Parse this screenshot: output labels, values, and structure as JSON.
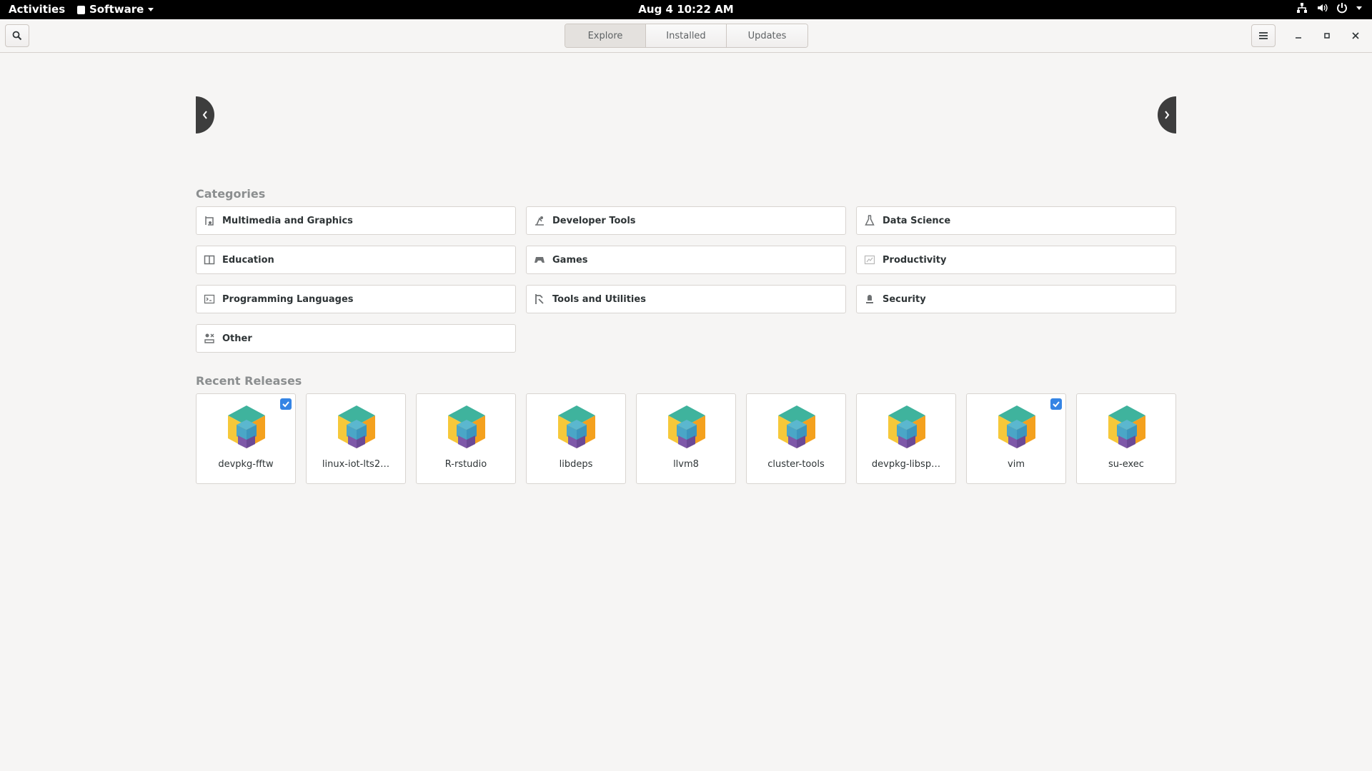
{
  "topbar": {
    "activities": "Activities",
    "app_menu": "Software",
    "clock": "Aug 4  10:22 AM"
  },
  "header": {
    "tabs": [
      {
        "label": "Explore",
        "active": true
      },
      {
        "label": "Installed",
        "active": false
      },
      {
        "label": "Updates",
        "active": false
      }
    ]
  },
  "categories": {
    "title": "Categories",
    "items": [
      {
        "label": "Multimedia and Graphics",
        "icon": "multimedia-icon"
      },
      {
        "label": "Developer Tools",
        "icon": "developer-tools-icon"
      },
      {
        "label": "Data Science",
        "icon": "flask-icon"
      },
      {
        "label": "Education",
        "icon": "book-icon"
      },
      {
        "label": "Games",
        "icon": "gamepad-icon"
      },
      {
        "label": "Productivity",
        "icon": "productivity-icon"
      },
      {
        "label": "Programming Languages",
        "icon": "terminal-icon"
      },
      {
        "label": "Tools and Utilities",
        "icon": "tools-icon"
      },
      {
        "label": "Security",
        "icon": "security-icon"
      },
      {
        "label": "Other",
        "icon": "other-icon"
      }
    ]
  },
  "recent": {
    "title": "Recent Releases",
    "apps": [
      {
        "name": "devpkg-fftw",
        "installed": true
      },
      {
        "name": "linux-iot-lts2…",
        "installed": false
      },
      {
        "name": "R-rstudio",
        "installed": false
      },
      {
        "name": "libdeps",
        "installed": false
      },
      {
        "name": "llvm8",
        "installed": false
      },
      {
        "name": "cluster-tools",
        "installed": false
      },
      {
        "name": "devpkg-libsp…",
        "installed": false
      },
      {
        "name": "vim",
        "installed": true
      },
      {
        "name": "su-exec",
        "installed": false
      }
    ]
  },
  "colors": {
    "accent": "#3584e4",
    "topbar": "#000000",
    "background": "#f6f5f4"
  }
}
